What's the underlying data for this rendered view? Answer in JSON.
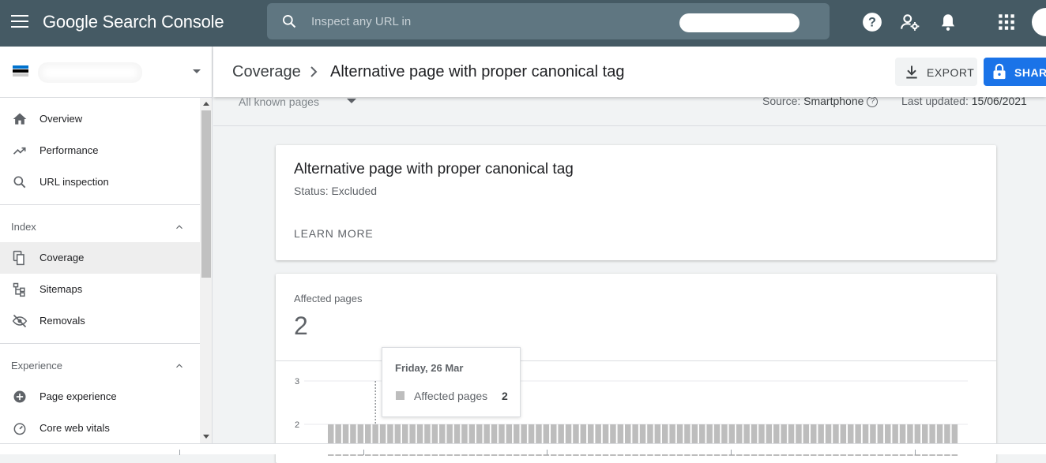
{
  "app": {
    "brand": "Google Search Console"
  },
  "search": {
    "placeholder": "Inspect any URL in"
  },
  "sidebar": {
    "primary": [
      {
        "label": "Overview",
        "icon": "home-icon"
      },
      {
        "label": "Performance",
        "icon": "trending-up-icon"
      },
      {
        "label": "URL inspection",
        "icon": "search-icon"
      }
    ],
    "index_section": "Index",
    "index_items": [
      {
        "label": "Coverage",
        "icon": "copy-pages-icon",
        "active": true
      },
      {
        "label": "Sitemaps",
        "icon": "sitemap-icon"
      },
      {
        "label": "Removals",
        "icon": "eye-off-icon"
      }
    ],
    "experience_section": "Experience",
    "experience_items": [
      {
        "label": "Page experience",
        "icon": "plus-circle-icon"
      },
      {
        "label": "Core web vitals",
        "icon": "speed-gauge-icon"
      }
    ]
  },
  "header": {
    "crumb_parent": "Coverage",
    "crumb_current": "Alternative page with proper canonical tag",
    "export_label": "EXPORT",
    "share_label": "SHAR"
  },
  "filters": {
    "pages": "All known pages",
    "source_label": "Source:",
    "source_value": "Smartphone",
    "updated_label": "Last updated:",
    "updated_value": "15/06/2021"
  },
  "issue_card": {
    "title": "Alternative page with proper canonical tag",
    "status": "Status: Excluded",
    "learn_more": "LEARN MORE"
  },
  "affected_card": {
    "label": "Affected pages",
    "count": "2"
  },
  "tooltip": {
    "date": "Friday, 26 Mar",
    "series": "Affected pages",
    "value": "2"
  },
  "colors": {
    "topbar": "#455a64",
    "search": "#5f7681",
    "accent": "#1a73e8",
    "bar": "#bdbdbd"
  },
  "chart_data": {
    "type": "bar",
    "title": "",
    "xlabel": "",
    "ylabel": "",
    "ylim": [
      0,
      3
    ],
    "y_ticks": [
      "3",
      "2"
    ],
    "series": [
      {
        "name": "Affected pages",
        "values": [
          2,
          2,
          2,
          2,
          2,
          2,
          2,
          2,
          2,
          2,
          2,
          2,
          2,
          2,
          2,
          2,
          2,
          2,
          2,
          2,
          2,
          2,
          2,
          2,
          2,
          2,
          2,
          2,
          2,
          2,
          2,
          2,
          2,
          2,
          2,
          2,
          2,
          2,
          2,
          2,
          2,
          2,
          2,
          2,
          2,
          2,
          2,
          2,
          2,
          2,
          2,
          2,
          2,
          2,
          2,
          2,
          2,
          2,
          2,
          2,
          2,
          2,
          2,
          2,
          2,
          2,
          2,
          2,
          2,
          2,
          2,
          2,
          2,
          2,
          2,
          2,
          2,
          2,
          2,
          2,
          2,
          2,
          2,
          2,
          2
        ]
      }
    ],
    "highlight_index": 6
  }
}
